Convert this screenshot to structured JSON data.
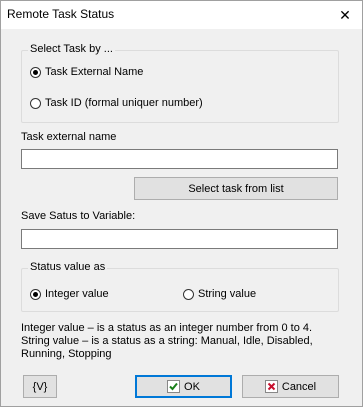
{
  "window": {
    "title": "Remote Task Status",
    "close_icon": "close-icon"
  },
  "select_task_group": {
    "legend": "Select Task by ...",
    "options": [
      {
        "label": "Task External Name",
        "checked": true
      },
      {
        "label": "Task ID (formal uniquer number)",
        "checked": false
      }
    ]
  },
  "task_name": {
    "label": "Task external name",
    "value": "",
    "select_button": "Select task from list"
  },
  "save_status": {
    "label": "Save Satus to Variable:",
    "value": ""
  },
  "status_value_group": {
    "legend": "Status value as",
    "options": [
      {
        "label": "Integer value",
        "checked": true
      },
      {
        "label": "String value",
        "checked": false
      }
    ]
  },
  "help_text": {
    "line1": "Integer value – is a status as an integer number from 0 to 4.",
    "line2": "String value – is a status as a string: Manual, Idle, Disabled,",
    "line3": "Running, Stopping"
  },
  "buttons": {
    "variables": "{V}",
    "ok": "OK",
    "cancel": "Cancel"
  },
  "colors": {
    "ok_check": "#1a7f1a",
    "cancel_x": "#c8102e",
    "default_border": "#0078d7"
  }
}
